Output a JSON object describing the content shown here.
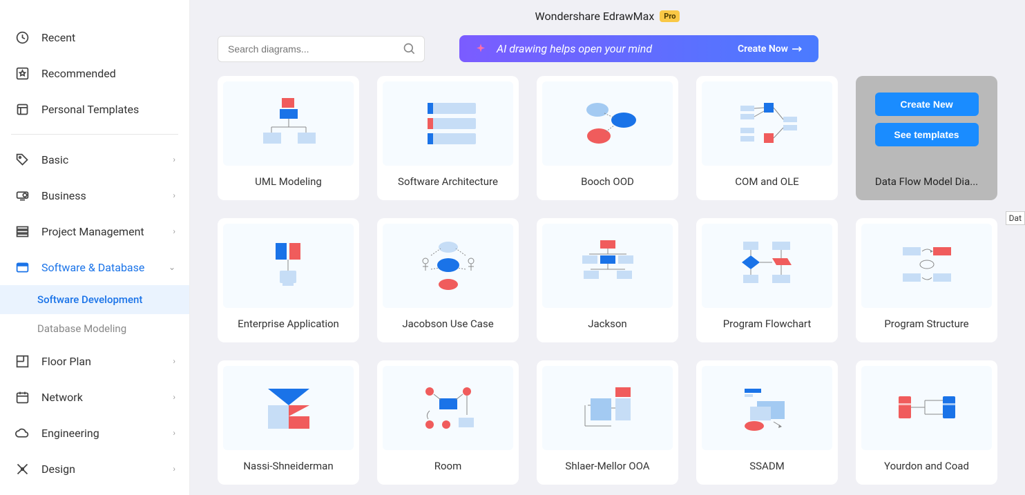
{
  "header": {
    "title": "Wondershare EdrawMax",
    "badge": "Pro"
  },
  "search": {
    "placeholder": "Search diagrams..."
  },
  "ai_banner": {
    "text": "AI drawing helps open your mind",
    "cta": "Create Now"
  },
  "sidebar": {
    "top": [
      {
        "label": "Recent",
        "icon": "clock"
      },
      {
        "label": "Recommended",
        "icon": "star-box"
      },
      {
        "label": "Personal Templates",
        "icon": "template"
      }
    ],
    "categories": [
      {
        "label": "Basic",
        "icon": "tag",
        "expand": true
      },
      {
        "label": "Business",
        "icon": "projector",
        "expand": true
      },
      {
        "label": "Project Management",
        "icon": "layers",
        "expand": true
      },
      {
        "label": "Software & Database",
        "icon": "window",
        "expand": true,
        "active": true,
        "children": [
          {
            "label": "Software Development",
            "active": true
          },
          {
            "label": "Database Modeling",
            "active": false
          }
        ]
      },
      {
        "label": "Floor Plan",
        "icon": "floorplan",
        "expand": true
      },
      {
        "label": "Network",
        "icon": "calendar",
        "expand": true
      },
      {
        "label": "Engineering",
        "icon": "cloud",
        "expand": true
      },
      {
        "label": "Design",
        "icon": "design",
        "expand": true
      }
    ]
  },
  "templates": [
    {
      "label": "UML Modeling",
      "thumb": "uml"
    },
    {
      "label": "Software Architecture",
      "thumb": "arch"
    },
    {
      "label": "Booch OOD",
      "thumb": "booch"
    },
    {
      "label": "COM and OLE",
      "thumb": "comole"
    },
    {
      "label": "Data Flow Model Dia...",
      "thumb": "dataflow",
      "hovered": true
    },
    {
      "label": "Enterprise Application",
      "thumb": "enterprise"
    },
    {
      "label": "Jacobson Use Case",
      "thumb": "jacobson"
    },
    {
      "label": "Jackson",
      "thumb": "jackson"
    },
    {
      "label": "Program Flowchart",
      "thumb": "flowchart"
    },
    {
      "label": "Program Structure",
      "thumb": "progstruct"
    },
    {
      "label": "Nassi-Shneiderman",
      "thumb": "nassi"
    },
    {
      "label": "Room",
      "thumb": "room"
    },
    {
      "label": "Shlaer-Mellor OOA",
      "thumb": "shlaer"
    },
    {
      "label": "SSADM",
      "thumb": "ssadm"
    },
    {
      "label": "Yourdon and Coad",
      "thumb": "yourdon"
    }
  ],
  "hover_actions": {
    "create": "Create New",
    "see": "See templates"
  },
  "tooltip_fragment": "Dat"
}
